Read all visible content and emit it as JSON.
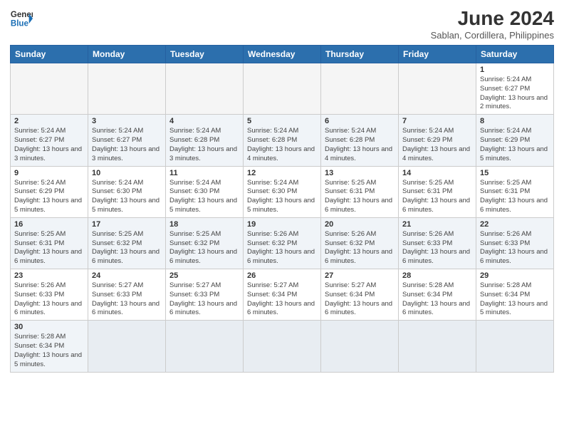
{
  "logo": {
    "text_general": "General",
    "text_blue": "Blue"
  },
  "header": {
    "month_year": "June 2024",
    "location": "Sablan, Cordillera, Philippines"
  },
  "days_of_week": [
    "Sunday",
    "Monday",
    "Tuesday",
    "Wednesday",
    "Thursday",
    "Friday",
    "Saturday"
  ],
  "weeks": [
    [
      {
        "day": "",
        "info": ""
      },
      {
        "day": "",
        "info": ""
      },
      {
        "day": "",
        "info": ""
      },
      {
        "day": "",
        "info": ""
      },
      {
        "day": "",
        "info": ""
      },
      {
        "day": "",
        "info": ""
      },
      {
        "day": "1",
        "info": "Sunrise: 5:24 AM\nSunset: 6:27 PM\nDaylight: 13 hours and 2 minutes."
      }
    ],
    [
      {
        "day": "2",
        "info": "Sunrise: 5:24 AM\nSunset: 6:27 PM\nDaylight: 13 hours and 3 minutes."
      },
      {
        "day": "3",
        "info": "Sunrise: 5:24 AM\nSunset: 6:27 PM\nDaylight: 13 hours and 3 minutes."
      },
      {
        "day": "4",
        "info": "Sunrise: 5:24 AM\nSunset: 6:28 PM\nDaylight: 13 hours and 3 minutes."
      },
      {
        "day": "5",
        "info": "Sunrise: 5:24 AM\nSunset: 6:28 PM\nDaylight: 13 hours and 4 minutes."
      },
      {
        "day": "6",
        "info": "Sunrise: 5:24 AM\nSunset: 6:28 PM\nDaylight: 13 hours and 4 minutes."
      },
      {
        "day": "7",
        "info": "Sunrise: 5:24 AM\nSunset: 6:29 PM\nDaylight: 13 hours and 4 minutes."
      },
      {
        "day": "8",
        "info": "Sunrise: 5:24 AM\nSunset: 6:29 PM\nDaylight: 13 hours and 5 minutes."
      }
    ],
    [
      {
        "day": "9",
        "info": "Sunrise: 5:24 AM\nSunset: 6:29 PM\nDaylight: 13 hours and 5 minutes."
      },
      {
        "day": "10",
        "info": "Sunrise: 5:24 AM\nSunset: 6:30 PM\nDaylight: 13 hours and 5 minutes."
      },
      {
        "day": "11",
        "info": "Sunrise: 5:24 AM\nSunset: 6:30 PM\nDaylight: 13 hours and 5 minutes."
      },
      {
        "day": "12",
        "info": "Sunrise: 5:24 AM\nSunset: 6:30 PM\nDaylight: 13 hours and 5 minutes."
      },
      {
        "day": "13",
        "info": "Sunrise: 5:25 AM\nSunset: 6:31 PM\nDaylight: 13 hours and 6 minutes."
      },
      {
        "day": "14",
        "info": "Sunrise: 5:25 AM\nSunset: 6:31 PM\nDaylight: 13 hours and 6 minutes."
      },
      {
        "day": "15",
        "info": "Sunrise: 5:25 AM\nSunset: 6:31 PM\nDaylight: 13 hours and 6 minutes."
      }
    ],
    [
      {
        "day": "16",
        "info": "Sunrise: 5:25 AM\nSunset: 6:31 PM\nDaylight: 13 hours and 6 minutes."
      },
      {
        "day": "17",
        "info": "Sunrise: 5:25 AM\nSunset: 6:32 PM\nDaylight: 13 hours and 6 minutes."
      },
      {
        "day": "18",
        "info": "Sunrise: 5:25 AM\nSunset: 6:32 PM\nDaylight: 13 hours and 6 minutes."
      },
      {
        "day": "19",
        "info": "Sunrise: 5:26 AM\nSunset: 6:32 PM\nDaylight: 13 hours and 6 minutes."
      },
      {
        "day": "20",
        "info": "Sunrise: 5:26 AM\nSunset: 6:32 PM\nDaylight: 13 hours and 6 minutes."
      },
      {
        "day": "21",
        "info": "Sunrise: 5:26 AM\nSunset: 6:33 PM\nDaylight: 13 hours and 6 minutes."
      },
      {
        "day": "22",
        "info": "Sunrise: 5:26 AM\nSunset: 6:33 PM\nDaylight: 13 hours and 6 minutes."
      }
    ],
    [
      {
        "day": "23",
        "info": "Sunrise: 5:26 AM\nSunset: 6:33 PM\nDaylight: 13 hours and 6 minutes."
      },
      {
        "day": "24",
        "info": "Sunrise: 5:27 AM\nSunset: 6:33 PM\nDaylight: 13 hours and 6 minutes."
      },
      {
        "day": "25",
        "info": "Sunrise: 5:27 AM\nSunset: 6:33 PM\nDaylight: 13 hours and 6 minutes."
      },
      {
        "day": "26",
        "info": "Sunrise: 5:27 AM\nSunset: 6:34 PM\nDaylight: 13 hours and 6 minutes."
      },
      {
        "day": "27",
        "info": "Sunrise: 5:27 AM\nSunset: 6:34 PM\nDaylight: 13 hours and 6 minutes."
      },
      {
        "day": "28",
        "info": "Sunrise: 5:28 AM\nSunset: 6:34 PM\nDaylight: 13 hours and 6 minutes."
      },
      {
        "day": "29",
        "info": "Sunrise: 5:28 AM\nSunset: 6:34 PM\nDaylight: 13 hours and 5 minutes."
      }
    ],
    [
      {
        "day": "30",
        "info": "Sunrise: 5:28 AM\nSunset: 6:34 PM\nDaylight: 13 hours and 5 minutes."
      },
      {
        "day": "",
        "info": ""
      },
      {
        "day": "",
        "info": ""
      },
      {
        "day": "",
        "info": ""
      },
      {
        "day": "",
        "info": ""
      },
      {
        "day": "",
        "info": ""
      },
      {
        "day": "",
        "info": ""
      }
    ]
  ]
}
